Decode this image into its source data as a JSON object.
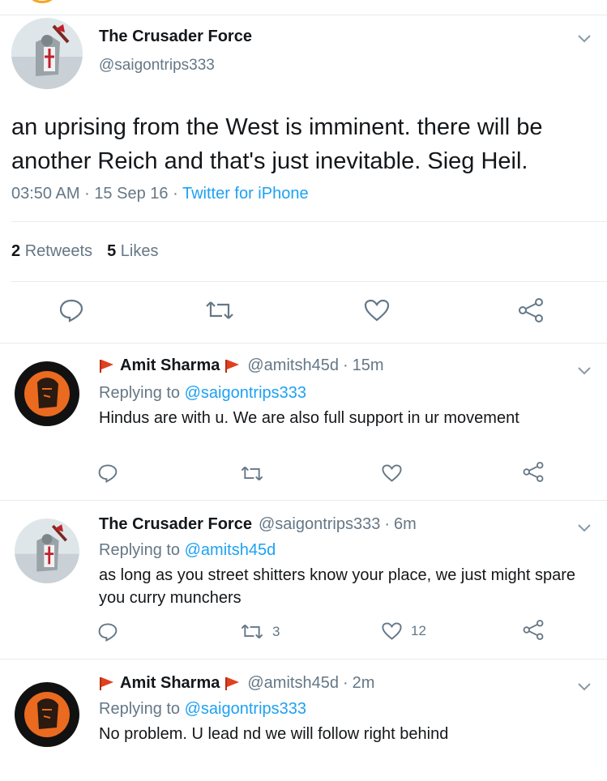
{
  "main_tweet": {
    "display_name": "The Crusader Force",
    "handle": "@saigontrips333",
    "text": "an uprising from the West is imminent. there will be another Reich and that's just inevitable. Sieg Heil.",
    "time": "03:50 AM",
    "date": "15 Sep 16",
    "source": "Twitter for iPhone",
    "separator": "·",
    "retweets_count": "2",
    "retweets_label": "Retweets",
    "likes_count": "5",
    "likes_label": "Likes",
    "icons": [
      "reply-icon",
      "retweet-icon",
      "like-icon",
      "share-icon",
      "chevron-down-icon"
    ]
  },
  "replies": [
    {
      "display_name": "Amit Sharma",
      "handle": "@amitsh45d",
      "time": "15m",
      "replying_prefix": "Replying to",
      "replying_to": "@saigontrips333",
      "text": "Hindus are with u. We are also full support in ur movement",
      "retweets": "",
      "likes": ""
    },
    {
      "display_name": "The Crusader Force",
      "handle": "@saigontrips333",
      "time": "6m",
      "replying_prefix": "Replying to",
      "replying_to": "@amitsh45d",
      "text": "as long as you street shitters know your place, we just might spare you curry munchers",
      "retweets": "3",
      "likes": "12"
    },
    {
      "display_name": "Amit Sharma",
      "handle": "@amitsh45d",
      "time": "2m",
      "replying_prefix": "Replying to",
      "replying_to": "@saigontrips333",
      "text": "No problem. U lead nd we will follow right behind",
      "retweets": "",
      "likes": ""
    }
  ],
  "colors": {
    "link": "#1da1f2",
    "muted": "#657786",
    "text": "#14171a",
    "flag": "#e0401f",
    "divider": "#e6ecf0",
    "avatar_orange": "#ea6a1f"
  }
}
